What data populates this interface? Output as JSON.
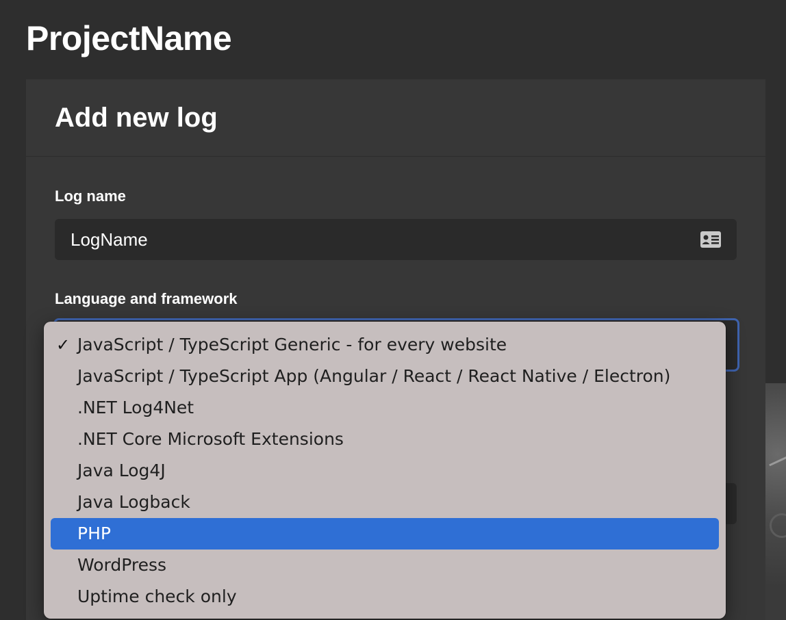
{
  "header": {
    "project_title": "ProjectName"
  },
  "card": {
    "title": "Add new log",
    "log_name_label": "Log name",
    "log_name_value": "LogName",
    "language_label": "Language and framework"
  },
  "dropdown": {
    "checked_index": 0,
    "highlighted_index": 6,
    "check_glyph": "✓",
    "options": [
      {
        "label": "JavaScript / TypeScript Generic - for every website"
      },
      {
        "label": "JavaScript / TypeScript App (Angular / React / React Native / Electron)"
      },
      {
        "label": ".NET Log4Net"
      },
      {
        "label": ".NET Core Microsoft Extensions"
      },
      {
        "label": "Java Log4J"
      },
      {
        "label": "Java Logback"
      },
      {
        "label": "PHP"
      },
      {
        "label": "WordPress"
      },
      {
        "label": "Uptime check only"
      }
    ]
  },
  "colors": {
    "page_bg": "#2e2e2e",
    "card_bg": "#373737",
    "input_bg": "#2a2a2a",
    "focus_border": "#3f64b0",
    "menu_bg": "#c6bebe",
    "menu_highlight": "#2f6fd5"
  },
  "icons": {
    "input_icon": "contact-card-icon",
    "checked_icon": "checkmark-icon"
  }
}
